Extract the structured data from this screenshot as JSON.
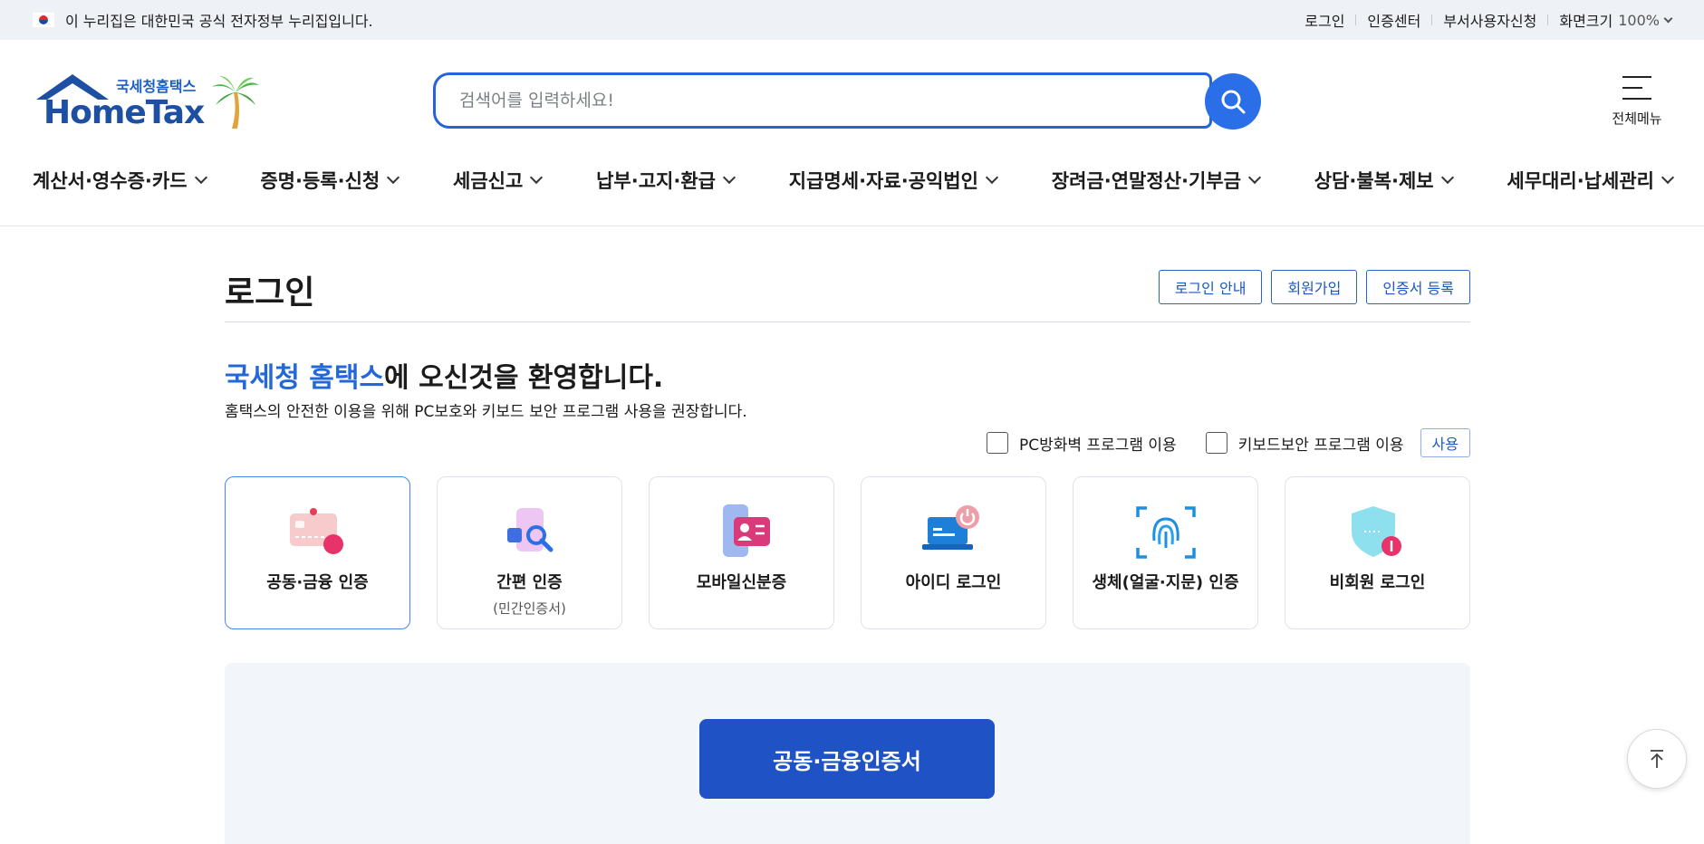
{
  "topbar": {
    "gov_notice": "이 누리집은 대한민국 공식 전자정부 누리집입니다.",
    "links": [
      "로그인",
      "인증센터",
      "부서사용자신청"
    ],
    "zoom_label": "화면크기",
    "zoom_value": "100%"
  },
  "header": {
    "logo_sub": "국세청홈택스",
    "logo_main": "HomeTax",
    "search_placeholder": "검색어를 입력하세요!",
    "all_menu_label": "전체메뉴"
  },
  "gnb": [
    "계산서·영수증·카드",
    "증명·등록·신청",
    "세금신고",
    "납부·고지·환급",
    "지급명세·자료·공익법인",
    "장려금·연말정산·기부금",
    "상담·불복·제보",
    "세무대리·납세관리"
  ],
  "page": {
    "title": "로그인",
    "buttons": [
      "로그인 안내",
      "회원가입",
      "인증서 등록"
    ],
    "welcome_highlight": "국세청 홈택스",
    "welcome_rest": "에 오신것을 환영합니다.",
    "description": "홈택스의 안전한 이용을 위해 PC보호와 키보드 보안 프로그램 사용을 권장합니다.",
    "options": [
      "PC방화벽 프로그램 이용",
      "키보드보안 프로그램 이용"
    ],
    "use_button": "사용"
  },
  "login_methods": [
    {
      "label": "공동·금융 인증",
      "sub": "",
      "icon": "certificate-card-icon",
      "selected": true
    },
    {
      "label": "간편 인증",
      "sub": "(민간인증서)",
      "icon": "simple-auth-icon",
      "selected": false
    },
    {
      "label": "모바일신분증",
      "sub": "",
      "icon": "mobile-id-icon",
      "selected": false
    },
    {
      "label": "아이디 로그인",
      "sub": "",
      "icon": "laptop-login-icon",
      "selected": false
    },
    {
      "label": "생체(얼굴·지문) 인증",
      "sub": "",
      "icon": "fingerprint-icon",
      "selected": false
    },
    {
      "label": "비회원 로그인",
      "sub": "",
      "icon": "shield-icon",
      "selected": false
    }
  ],
  "panel": {
    "main_button": "공동·금융인증서"
  },
  "colors": {
    "accent": "#2468d8",
    "primary_button": "#1f52c4",
    "topbar_bg": "#eef1f6",
    "panel_bg": "#f2f5fa"
  }
}
